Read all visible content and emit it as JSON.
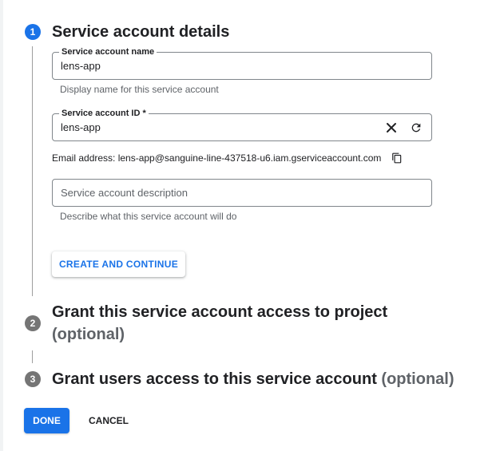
{
  "steps": [
    {
      "number": "1",
      "title": "Service account details",
      "optional": ""
    },
    {
      "number": "2",
      "title": "Grant this service account access to project",
      "optional": "(optional)"
    },
    {
      "number": "3",
      "title": "Grant users access to this service account",
      "optional": "(optional)"
    }
  ],
  "form": {
    "name": {
      "label": "Service account name",
      "value": "lens-app",
      "hint": "Display name for this service account"
    },
    "id": {
      "label": "Service account ID *",
      "value": "lens-app",
      "clear_icon": "close-icon",
      "refresh_icon": "refresh-icon"
    },
    "email": {
      "text": "Email address: lens-app@sanguine-line-437518-u6.iam.gserviceaccount.com",
      "copy_icon": "copy-icon"
    },
    "description": {
      "placeholder": "Service account description",
      "hint": "Describe what this service account will do"
    }
  },
  "buttons": {
    "create": "CREATE AND CONTINUE",
    "done": "DONE",
    "cancel": "CANCEL"
  },
  "colors": {
    "accent": "#1a73e8",
    "inactive_step": "#757575"
  }
}
